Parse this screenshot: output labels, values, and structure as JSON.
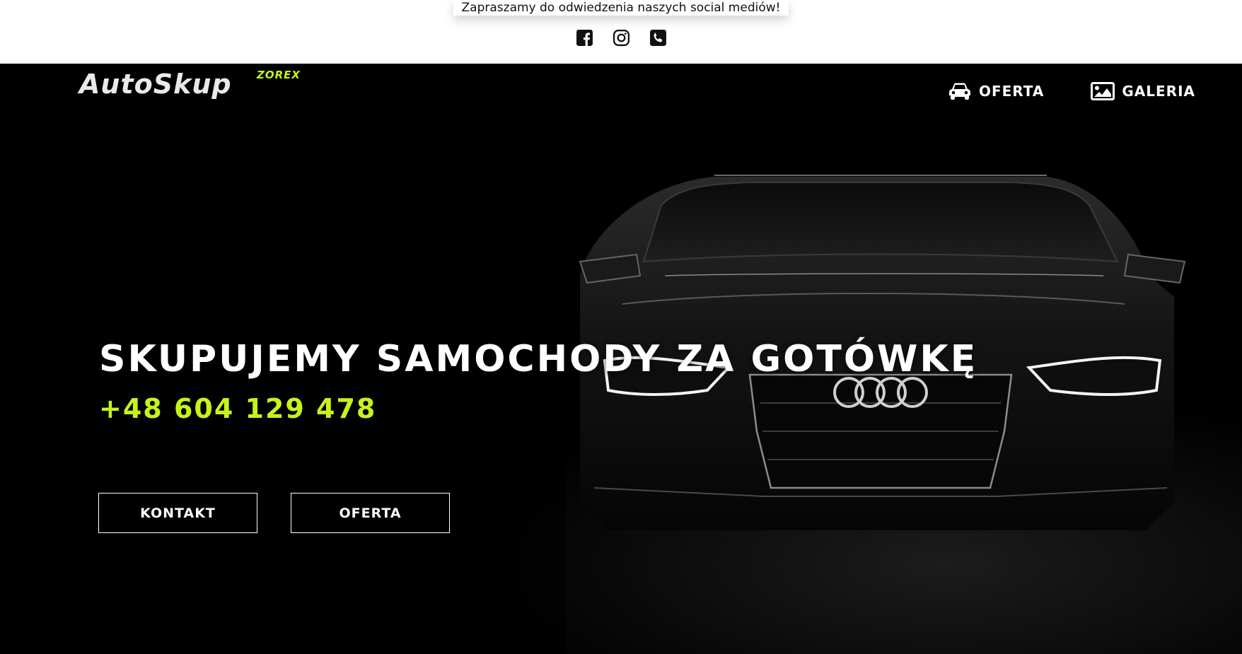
{
  "topbar": {
    "message": "Zapraszamy do odwiedzenia naszych social mediów!",
    "socials": [
      {
        "icon": "facebook-icon"
      },
      {
        "icon": "instagram-icon"
      },
      {
        "icon": "phone-icon"
      }
    ]
  },
  "header": {
    "logo_main": "AutoSkup",
    "logo_sub": "ZOREX",
    "nav": [
      {
        "label": "OFERTA",
        "icon": "car-icon"
      },
      {
        "label": "GALERIA",
        "icon": "image-icon"
      }
    ]
  },
  "hero": {
    "headline": "SKUPUJEMY SAMOCHODY ZA GOTÓWKĘ",
    "phone": "+48 604 129 478",
    "buttons": {
      "kontakt": "KONTAKT",
      "oferta": "OFERTA"
    }
  },
  "colors": {
    "accent": "#c6f31c",
    "background": "#000000",
    "topbar": "#ffffff"
  }
}
